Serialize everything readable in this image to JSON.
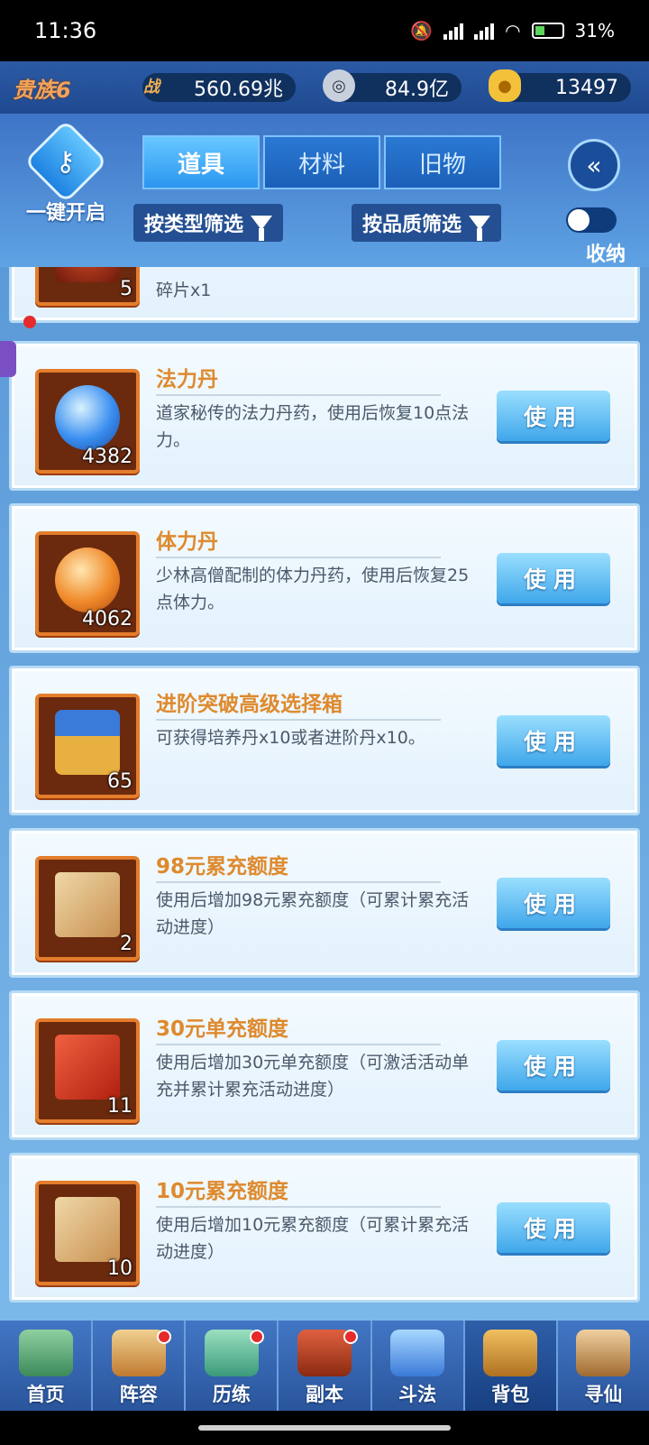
{
  "status": {
    "time": "11:36",
    "battery": "31%"
  },
  "resources": {
    "vip": "贵族6",
    "power_icon": "战",
    "power": "560.69兆",
    "silver": "84.9亿",
    "gold": "13497"
  },
  "header": {
    "onekey_label": "一键开启",
    "tabs": [
      {
        "label": "道具",
        "active": true
      },
      {
        "label": "材料",
        "active": false
      },
      {
        "label": "旧物",
        "active": false
      }
    ],
    "filter_type": "按类型筛选",
    "filter_quality": "按品质筛选",
    "fold_label": "收纳"
  },
  "items": [
    {
      "name": "",
      "desc": "碎片x1",
      "count": "5",
      "button": ""
    },
    {
      "name": "法力丹",
      "desc": "道家秘传的法力丹药，使用后恢复10点法力。",
      "count": "4382",
      "button": "使用"
    },
    {
      "name": "体力丹",
      "desc": "少林高僧配制的体力丹药，使用后恢复25点体力。",
      "count": "4062",
      "button": "使用"
    },
    {
      "name": "进阶突破高级选择箱",
      "desc": "可获得培养丹x10或者进阶丹x10。",
      "count": "65",
      "button": "使用"
    },
    {
      "name": "98元累充额度",
      "desc": "使用后增加98元累充额度（可累计累充活动进度）",
      "count": "2",
      "button": "使用"
    },
    {
      "name": "30元单充额度",
      "desc": "使用后增加30元单充额度（可激活活动单充并累计累充活动进度）",
      "count": "11",
      "button": "使用"
    },
    {
      "name": "10元累充额度",
      "desc": "使用后增加10元累充额度（可累计累充活动进度）",
      "count": "10",
      "button": "使用"
    }
  ],
  "nav": [
    {
      "label": "首页",
      "dot": false
    },
    {
      "label": "阵容",
      "dot": true
    },
    {
      "label": "历练",
      "dot": true
    },
    {
      "label": "副本",
      "dot": true
    },
    {
      "label": "斗法",
      "dot": false
    },
    {
      "label": "背包",
      "dot": false,
      "active": true
    },
    {
      "label": "寻仙",
      "dot": false
    }
  ]
}
